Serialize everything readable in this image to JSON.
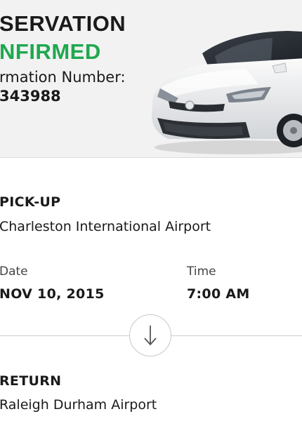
{
  "header": {
    "status_line_1": "SERVATION",
    "status_line_2": "NFIRMED",
    "confirmation_label": "rmation Number:",
    "confirmation_number": "343988",
    "confirmed_color": "#1fa84f"
  },
  "pickup": {
    "heading": "PICK-UP",
    "location": "Charleston International Airport",
    "date_label": "Date",
    "date_value": "NOV 10, 2015",
    "time_label": "Time",
    "time_value": "7:00 AM"
  },
  "divider_icon": "arrow-down-icon",
  "return": {
    "heading": "RETURN",
    "location": "Raleigh Durham Airport"
  }
}
